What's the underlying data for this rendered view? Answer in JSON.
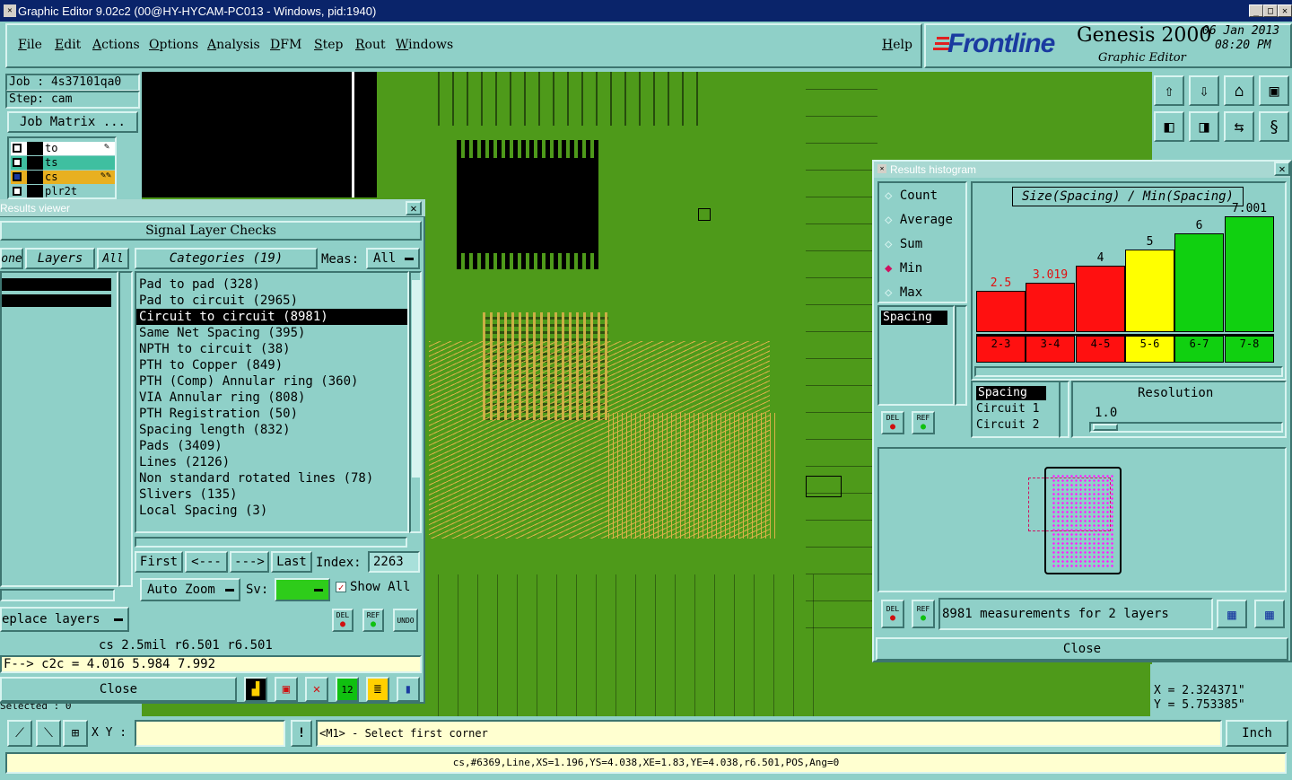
{
  "window": {
    "title": "Graphic Editor 9.02c2 (00@HY-HYCAM-PC013 - Windows, pid:1940)",
    "min": "_",
    "max": "□",
    "close": "✕"
  },
  "menu": {
    "items": [
      "File",
      "Edit",
      "Actions",
      "Options",
      "Analysis",
      "DFM",
      "Step",
      "Rout",
      "Windows"
    ],
    "help": "Help"
  },
  "brand": {
    "logo": "Frontline",
    "product": "Genesis 2000",
    "subtitle": "Graphic Editor",
    "date": "06 Jan 2013",
    "time": "08:20 PM"
  },
  "job": {
    "job": "Job : 4s37101qa0",
    "step": "Step: cam",
    "matrix": "Job Matrix ..."
  },
  "layers": [
    {
      "name": "to",
      "color": "#ffffff"
    },
    {
      "name": "ts",
      "color": "#3fbfa0"
    },
    {
      "name": "cs",
      "color": "#e8b020"
    },
    {
      "name": "plr2t",
      "color": "#8fd0c8"
    }
  ],
  "results_viewer": {
    "title": "Results viewer",
    "header": "Signal Layer Checks",
    "left_tab": "one",
    "layers_tab": "Layers",
    "all_tab": "All",
    "categories_tab": "Categories (19)",
    "meas_label": "Meas:",
    "meas_value": "All",
    "categories": [
      "Pad to pad (328)",
      "Pad to circuit (2965)",
      "Circuit to circuit (8981)",
      "Same Net Spacing (395)",
      "NPTH to circuit (38)",
      "PTH to Copper (849)",
      "PTH (Comp) Annular ring (360)",
      "VIA Annular ring (808)",
      "PTH Registration (50)",
      "Spacing length (832)",
      "Pads (3409)",
      "Lines (2126)",
      "Non standard rotated lines (78)",
      "Slivers (135)",
      "Local Spacing (3)"
    ],
    "selected_index": 2,
    "nav": {
      "first": "First",
      "prev": "<---",
      "next": "--->",
      "last": "Last",
      "index_label": "Index:",
      "index_value": "2263"
    },
    "auto_zoom": "Auto Zoom",
    "sv_label": "Sv:",
    "show_all": "Show All",
    "replace_layers": "eplace layers",
    "del": "DEL",
    "ref": "REF",
    "undo": "UNDO",
    "measure_line": "cs 2.5mil  r6.501  r6.501",
    "c2c_line": "F--> c2c = 4.016 5.984 7.992",
    "close": "Close",
    "selected_label": "Selected : 0"
  },
  "histogram": {
    "title": "Results histogram",
    "modes": [
      "Count",
      "Average",
      "Sum",
      "Min",
      "Max"
    ],
    "selected_mode": "Min",
    "list_item": "Spacing",
    "chart_title": "Size(Spacing) / Min(Spacing)",
    "resolution_label": "Resolution",
    "resolution_value": "1.0",
    "legend": [
      "Spacing",
      "Circuit 1",
      "Circuit 2"
    ],
    "summary": "8981 measurements for 2 layers",
    "close": "Close",
    "del": "DEL",
    "ref": "REF"
  },
  "chart_data": {
    "type": "bar",
    "title": "Size(Spacing) / Min(Spacing)",
    "categories": [
      "2-3",
      "3-4",
      "4-5",
      "5-6",
      "6-7",
      "7-8"
    ],
    "values": [
      2.5,
      3.019,
      4,
      5,
      6,
      7.001
    ],
    "value_labels": [
      "2.5",
      "3.019",
      "4",
      "5",
      "6",
      "7.001"
    ],
    "colors": [
      "#ff1010",
      "#ff1010",
      "#ff1010",
      "#ffff00",
      "#10d010",
      "#10d010"
    ],
    "ylim": [
      0,
      8
    ]
  },
  "coords": {
    "x": "X = 2.324371\"",
    "y": "Y = 5.753385\""
  },
  "statusbar": {
    "xy_label": "X Y :",
    "xy_value": "",
    "hint": "<M1> - Select first corner",
    "units": "Inch",
    "info": "cs,#6369,Line,XS=1.196,YS=4.038,XE=1.83,YE=4.038,r6.501,POS,Ang=0"
  },
  "colors": {
    "panel": "#8fd0c8",
    "board": "#4e9a1a",
    "copper": "#d9b24a",
    "titlebar": "#0a246a"
  }
}
